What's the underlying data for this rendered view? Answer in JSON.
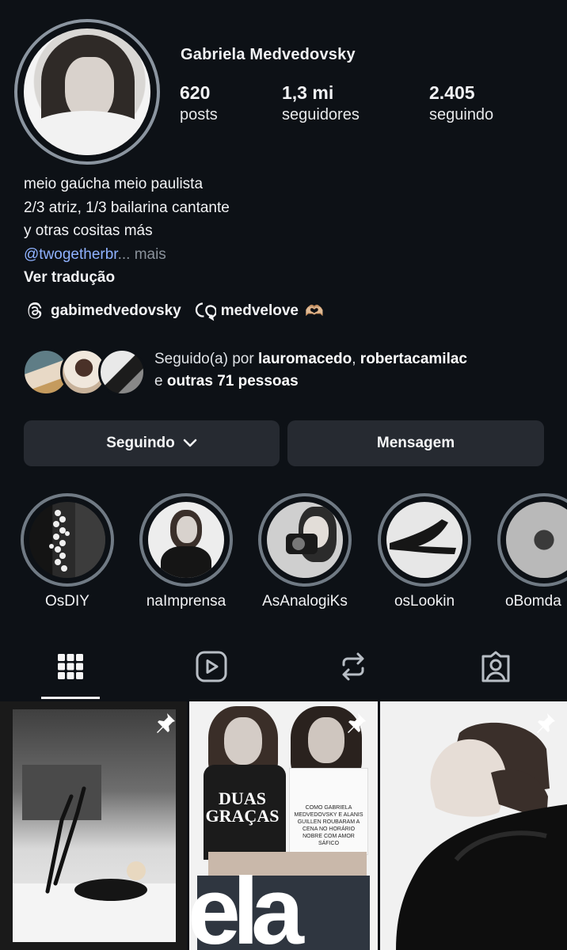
{
  "profile": {
    "name": "Gabriela Medvedovsky",
    "stats": [
      {
        "num": "620",
        "label": "posts"
      },
      {
        "num": "1,3 mi",
        "label": "seguidores"
      },
      {
        "num": "2.405",
        "label": "seguindo"
      }
    ]
  },
  "bio": {
    "line1": "meio gaúcha meio paulista",
    "line2": "2/3 atriz, 1/3 bailarina cantante",
    "line3": "y otras cositas más",
    "link": "@twogetherbr",
    "more": "... mais",
    "translate": "Ver tradução"
  },
  "links": {
    "threads_handle": "gabimedvedovsky",
    "secondary_handle": "medvelove",
    "emoji": "🫶🏼"
  },
  "followed_by": {
    "prefix": "Seguido(a) por ",
    "user1": "lauromacedo",
    "sep": ", ",
    "user2": "robertacamilac",
    "and": "e ",
    "others": "outras 71 pessoas"
  },
  "buttons": {
    "following": "Seguindo",
    "message": "Mensagem"
  },
  "highlights": [
    "OsDIY",
    "naImprensa",
    "AsAnalogiKs",
    "osLookin",
    "oBomda"
  ],
  "tabs": [
    "grid-icon",
    "reels-icon",
    "reposts-icon",
    "tagged-icon"
  ],
  "posts": {
    "post2_headline1": "DUAS",
    "post2_headline2": "GRAÇAS",
    "post2_logo": "ela",
    "post2_caption": "COMO GABRIELA MEDVEDOVSKY E ALANIS GUILLEN ROUBARAM A CENA NO HORÁRIO NOBRE COM AMOR SÁFICO"
  },
  "colors": {
    "background": "#0d1116",
    "button": "#262a31",
    "link": "#8fb2ff",
    "ring": "#8b95a0"
  }
}
